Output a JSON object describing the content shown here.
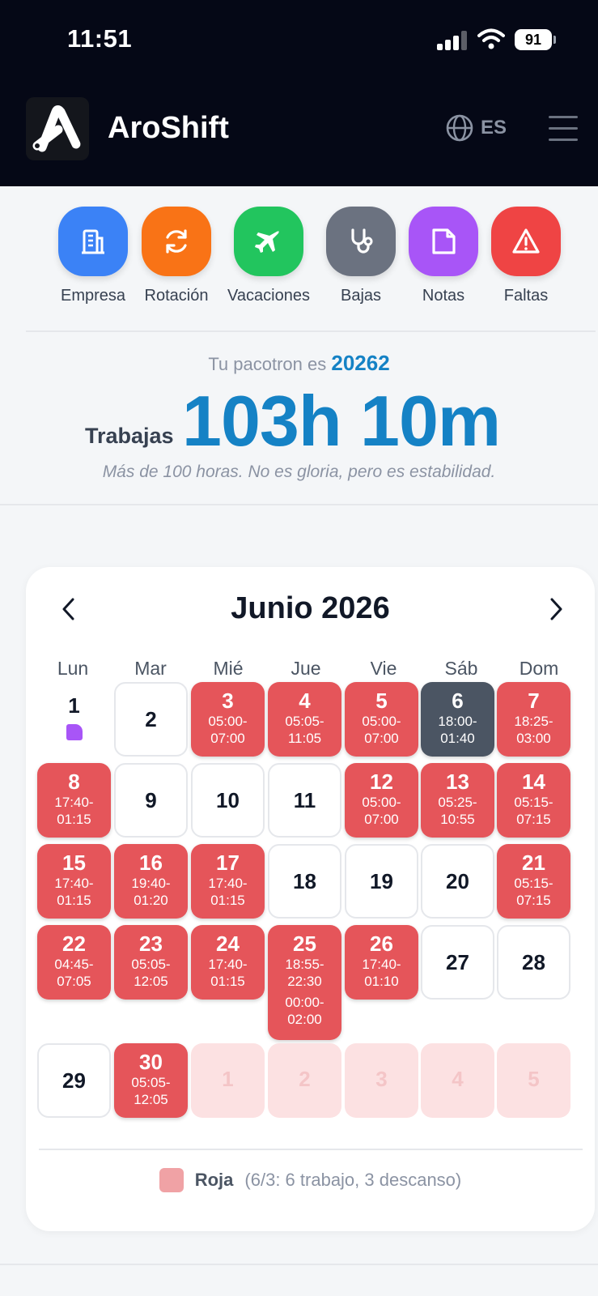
{
  "status_bar": {
    "time": "11:51",
    "battery": "91"
  },
  "header": {
    "brand": "AroShift",
    "language": "ES"
  },
  "actions": [
    {
      "label": "Empresa",
      "color": "#3b82f6",
      "icon": "building-icon"
    },
    {
      "label": "Rotación",
      "color": "#f97316",
      "icon": "refresh-icon"
    },
    {
      "label": "Vacaciones",
      "color": "#22c55e",
      "icon": "plane-icon"
    },
    {
      "label": "Bajas",
      "color": "#6b7280",
      "icon": "stethoscope-icon"
    },
    {
      "label": "Notas",
      "color": "#a855f7",
      "icon": "note-icon"
    },
    {
      "label": "Faltas",
      "color": "#ef4444",
      "icon": "warning-icon"
    }
  ],
  "summary": {
    "pacotron_prefix": "Tu pacotron es",
    "pacotron_number": "20262",
    "works_label": "Trabajas",
    "hours": "103h 10m",
    "quote": "Más de 100 horas. No es gloria, pero es estabilidad."
  },
  "calendar": {
    "month": "Junio 2026",
    "weekdays": [
      "Lun",
      "Mar",
      "Mié",
      "Jue",
      "Vie",
      "Sáb",
      "Dom"
    ],
    "weeks": [
      [
        {
          "n": "1",
          "type": "note",
          "times": []
        },
        {
          "n": "2",
          "type": "empty",
          "times": []
        },
        {
          "n": "3",
          "type": "work",
          "times": [
            "05:00-",
            "07:00"
          ]
        },
        {
          "n": "4",
          "type": "work",
          "times": [
            "05:05-",
            "11:05"
          ]
        },
        {
          "n": "5",
          "type": "work",
          "times": [
            "05:00-",
            "07:00"
          ]
        },
        {
          "n": "6",
          "type": "night",
          "times": [
            "18:00-",
            "01:40"
          ]
        },
        {
          "n": "7",
          "type": "work",
          "times": [
            "18:25-",
            "03:00"
          ]
        }
      ],
      [
        {
          "n": "8",
          "type": "work",
          "times": [
            "17:40-",
            "01:15"
          ]
        },
        {
          "n": "9",
          "type": "empty",
          "times": []
        },
        {
          "n": "10",
          "type": "empty",
          "times": []
        },
        {
          "n": "11",
          "type": "empty",
          "times": []
        },
        {
          "n": "12",
          "type": "work",
          "times": [
            "05:00-",
            "07:00"
          ]
        },
        {
          "n": "13",
          "type": "work",
          "times": [
            "05:25-",
            "10:55"
          ]
        },
        {
          "n": "14",
          "type": "work",
          "times": [
            "05:15-",
            "07:15"
          ]
        }
      ],
      [
        {
          "n": "15",
          "type": "work",
          "times": [
            "17:40-",
            "01:15"
          ]
        },
        {
          "n": "16",
          "type": "work",
          "times": [
            "19:40-",
            "01:20"
          ]
        },
        {
          "n": "17",
          "type": "work",
          "times": [
            "17:40-",
            "01:15"
          ]
        },
        {
          "n": "18",
          "type": "empty",
          "times": []
        },
        {
          "n": "19",
          "type": "empty",
          "times": []
        },
        {
          "n": "20",
          "type": "empty",
          "times": []
        },
        {
          "n": "21",
          "type": "work",
          "times": [
            "05:15-",
            "07:15"
          ]
        }
      ],
      [
        {
          "n": "22",
          "type": "work",
          "times": [
            "04:45-",
            "07:05"
          ]
        },
        {
          "n": "23",
          "type": "work",
          "times": [
            "05:05-",
            "12:05"
          ]
        },
        {
          "n": "24",
          "type": "work",
          "times": [
            "17:40-",
            "01:15"
          ]
        },
        {
          "n": "25",
          "type": "work",
          "times": [
            "18:55-",
            "22:30",
            "00:00-",
            "02:00"
          ]
        },
        {
          "n": "26",
          "type": "work",
          "times": [
            "17:40-",
            "01:10"
          ]
        },
        {
          "n": "27",
          "type": "empty",
          "times": []
        },
        {
          "n": "28",
          "type": "empty",
          "times": []
        }
      ],
      [
        {
          "n": "29",
          "type": "empty",
          "times": []
        },
        {
          "n": "30",
          "type": "work",
          "times": [
            "05:05-",
            "12:05"
          ]
        },
        {
          "n": "1",
          "type": "outside",
          "times": []
        },
        {
          "n": "2",
          "type": "outside",
          "times": []
        },
        {
          "n": "3",
          "type": "outside",
          "times": []
        },
        {
          "n": "4",
          "type": "outside",
          "times": []
        },
        {
          "n": "5",
          "type": "outside",
          "times": []
        }
      ]
    ],
    "legend": {
      "name": "Roja",
      "description": "(6/3: 6 trabajo, 3 descanso)",
      "color": "#f0a2a5"
    }
  }
}
